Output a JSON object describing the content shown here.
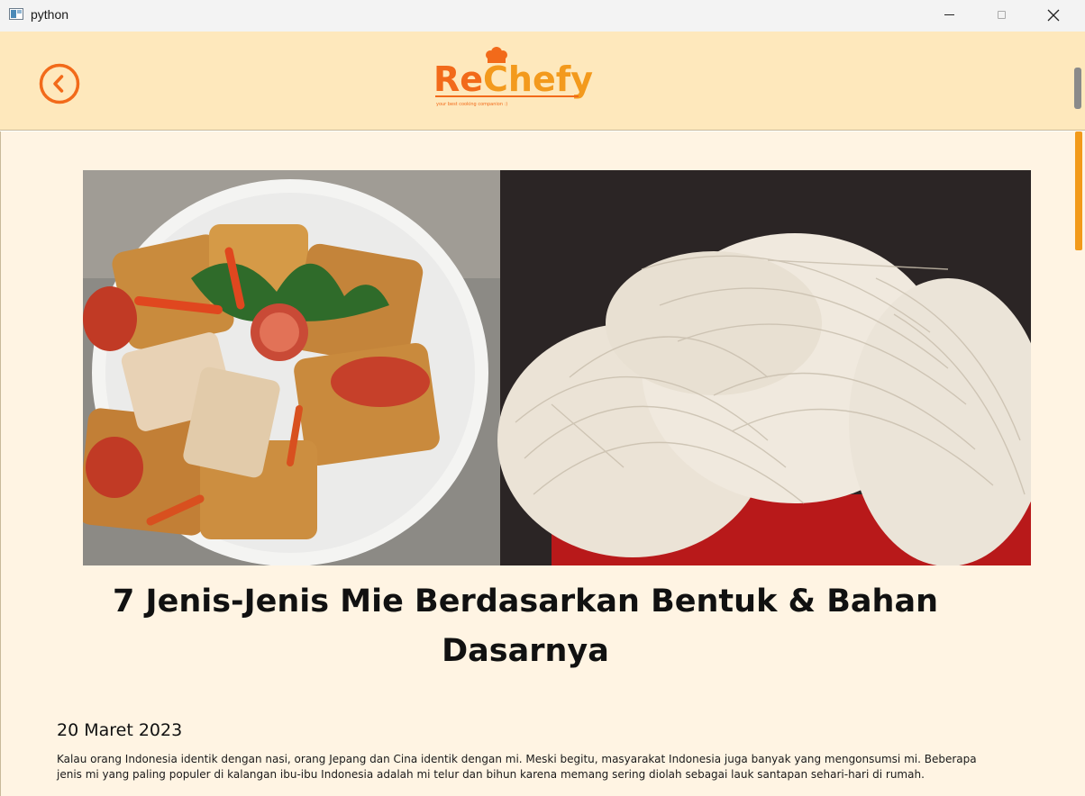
{
  "window": {
    "title": "python"
  },
  "header": {
    "logo_part1": "Re",
    "logo_part2": "Chefy",
    "logo_tagline": "your best cooking companion :)",
    "colors": {
      "background": "#fee8bc",
      "accent": "#f26a1a",
      "logo_orange": "#f39a1d"
    }
  },
  "article": {
    "title": "7 Jenis-Jenis Mie Berdasarkan Bentuk & Bahan Dasarnya",
    "date": "20 Maret 2023",
    "body": "Kalau orang Indonesia identik dengan nasi, orang Jepang dan Cina identik dengan mi. Meski begitu, masyarakat Indonesia juga banyak yang mengonsumsi mi. Beberapa jenis mi yang paling populer di kalangan ibu-ibu Indonesia adalah mi telur dan bihun karena memang sering diolah sebagai lauk santapan sehari-hari di rumah."
  },
  "icons": {
    "back": "back-arrow-circle-icon",
    "minimize": "minimize-icon",
    "maximize": "maximize-icon",
    "close": "close-icon"
  }
}
